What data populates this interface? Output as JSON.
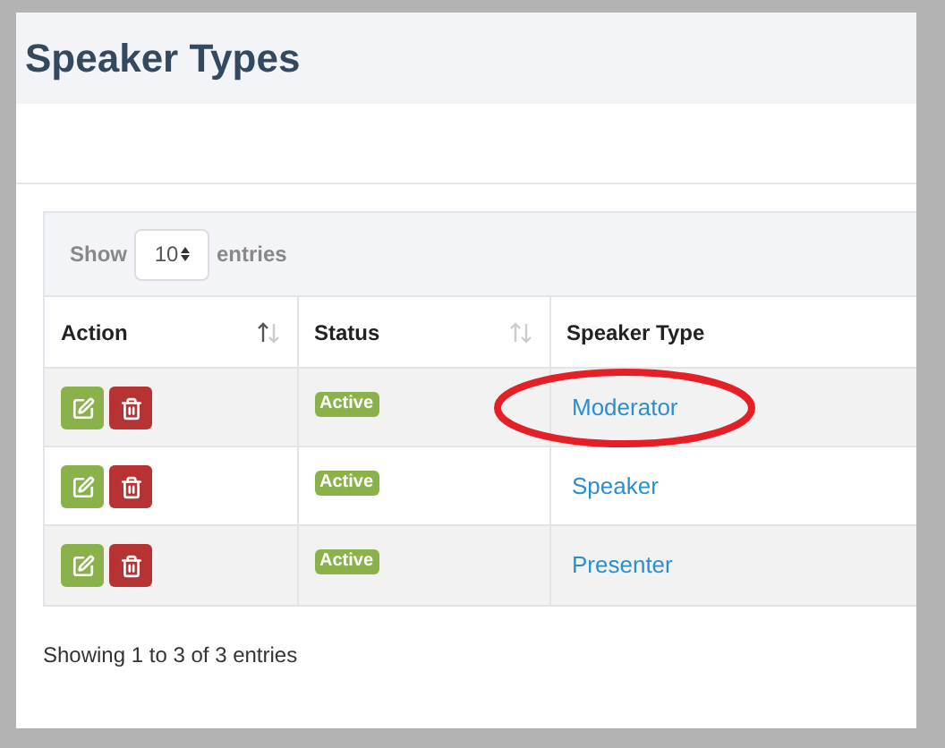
{
  "page_title": "Speaker Types",
  "length_menu": {
    "label_before": "Show",
    "value": "10",
    "label_after": "entries"
  },
  "table": {
    "columns": [
      {
        "label": "Action",
        "sortable": true,
        "sorted": true
      },
      {
        "label": "Status",
        "sortable": true,
        "sorted": false
      },
      {
        "label": "Speaker Type"
      }
    ],
    "rows": [
      {
        "status": "Active",
        "speaker_type": "Moderator",
        "highlighted": true
      },
      {
        "status": "Active",
        "speaker_type": "Speaker",
        "highlighted": false
      },
      {
        "status": "Active",
        "speaker_type": "Presenter",
        "highlighted": false
      }
    ]
  },
  "info": "Showing 1 to 3 of 3 entries"
}
